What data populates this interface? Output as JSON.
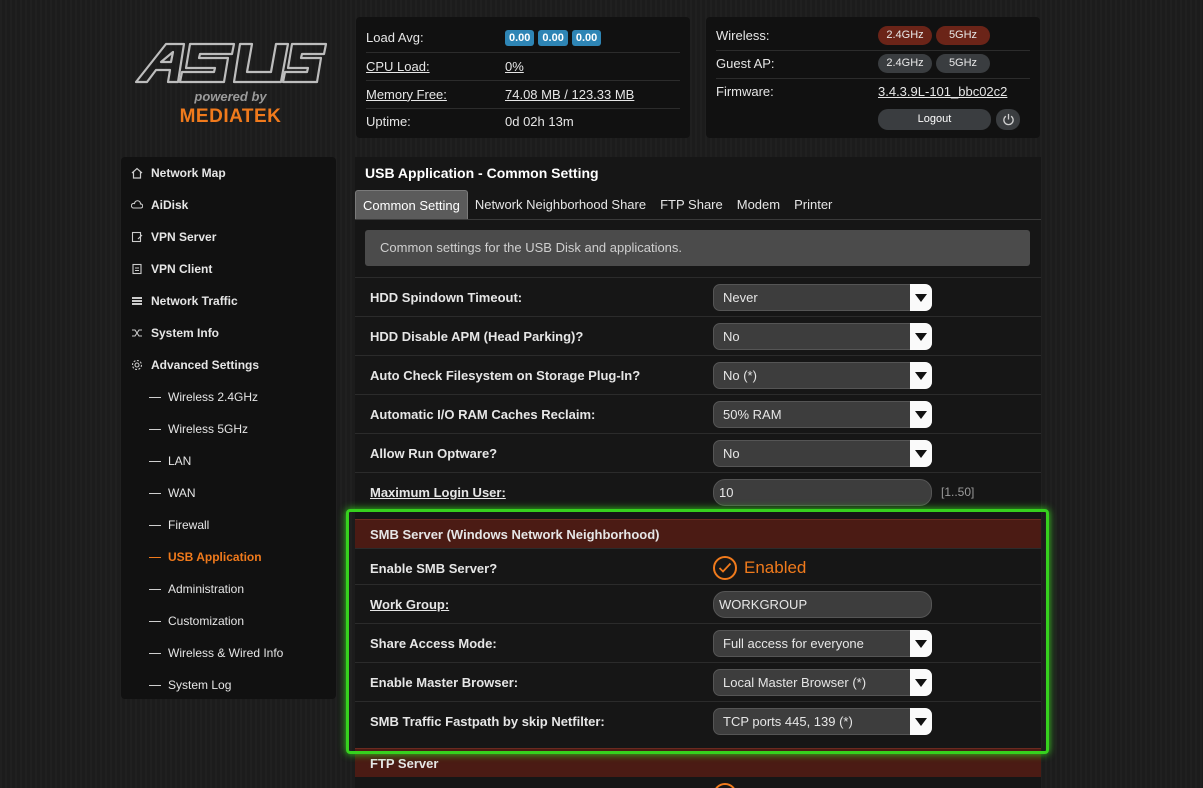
{
  "brand": {
    "logo": "ASUS",
    "powered_by": "powered by",
    "partner": "MEDIATEK"
  },
  "status": {
    "load_avg_label": "Load Avg:",
    "load_avg": [
      "0.00",
      "0.00",
      "0.00"
    ],
    "cpu_load_label": "CPU Load:",
    "cpu_load": "0%",
    "memory_label": "Memory Free:",
    "memory": "74.08 MB / 123.33 MB",
    "uptime_label": "Uptime:",
    "uptime": "0d 02h 13m",
    "wireless_label": "Wireless:",
    "wireless_24": "2.4GHz",
    "wireless_5": "5GHz",
    "guest_label": "Guest AP:",
    "guest_24": "2.4GHz",
    "guest_5": "5GHz",
    "firmware_label": "Firmware:",
    "firmware": "3.4.3.9L-101_bbc02c2",
    "logout": "Logout"
  },
  "sidebar": {
    "items": [
      {
        "label": "Network Map",
        "icon": "home-icon"
      },
      {
        "label": "AiDisk",
        "icon": "cloud-icon"
      },
      {
        "label": "VPN Server",
        "icon": "vpn-server-icon"
      },
      {
        "label": "VPN Client",
        "icon": "vpn-client-icon"
      },
      {
        "label": "Network Traffic",
        "icon": "traffic-icon"
      },
      {
        "label": "System Info",
        "icon": "shuffle-icon"
      },
      {
        "label": "Advanced Settings",
        "icon": "gear-icon"
      }
    ],
    "subitems": [
      "Wireless 2.4GHz",
      "Wireless 5GHz",
      "LAN",
      "WAN",
      "Firewall",
      "USB Application",
      "Administration",
      "Customization",
      "Wireless & Wired Info",
      "System Log"
    ],
    "active_subitem": "USB Application"
  },
  "main": {
    "title": "USB Application - Common Setting",
    "tabs": [
      "Common Setting",
      "Network Neighborhood Share",
      "FTP Share",
      "Modem",
      "Printer"
    ],
    "active_tab": "Common Setting",
    "description": "Common settings for the USB Disk and applications.",
    "settings": [
      {
        "label": "HDD Spindown Timeout:",
        "value": "Never"
      },
      {
        "label": "HDD Disable APM (Head Parking)?",
        "value": "No"
      },
      {
        "label": "Auto Check Filesystem on Storage Plug-In?",
        "value": "No (*)"
      },
      {
        "label": "Automatic I/O RAM Caches Reclaim:",
        "value": "50% RAM"
      },
      {
        "label": "Allow Run Optware?",
        "value": "No"
      }
    ],
    "max_login_label": "Maximum Login User:",
    "max_login_value": "10",
    "max_login_hint": "[1..50]",
    "smb": {
      "title": "SMB Server (Windows Network Neighborhood)",
      "enable_label": "Enable SMB Server?",
      "enable_value": "Enabled",
      "workgroup_label": "Work Group:",
      "workgroup_value": "WORKGROUP",
      "access_label": "Share Access Mode:",
      "access_value": "Full access for everyone",
      "master_label": "Enable Master Browser:",
      "master_value": "Local Master Browser (*)",
      "fastpath_label": "SMB Traffic Fastpath by skip Netfilter:",
      "fastpath_value": "TCP ports 445, 139 (*)"
    },
    "ftp": {
      "title": "FTP Server"
    }
  },
  "colors": {
    "accent": "#f07a1c",
    "badge_blue": "#2e85b5",
    "section_red": "#4b1b14",
    "highlight_green": "#36d11e"
  }
}
